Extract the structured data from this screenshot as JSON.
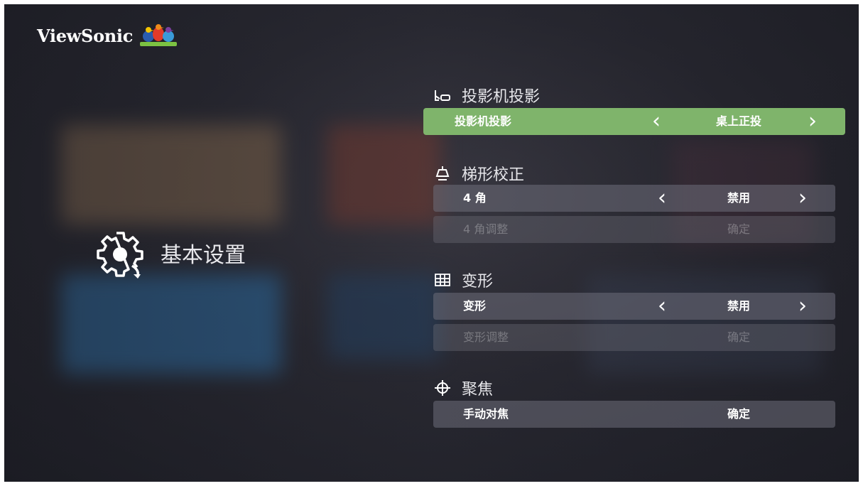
{
  "brand": {
    "name": "ViewSonic",
    "logo_icon": "viewsonic-birds-logo"
  },
  "left_menu": {
    "icon": "gear-icon",
    "title": "基本设置"
  },
  "sections": [
    {
      "title": "投影机投影",
      "icon": "projector-icon",
      "rows": [
        {
          "label": "投影机投影",
          "value": "桌上正投",
          "arrows": true,
          "selected": true,
          "enabled": true
        }
      ]
    },
    {
      "title": "梯形校正",
      "icon": "keystone-icon",
      "rows": [
        {
          "label": "4 角",
          "value": "禁用",
          "arrows": true,
          "selected": false,
          "enabled": true
        },
        {
          "label": "4 角调整",
          "value": "确定",
          "arrows": false,
          "selected": false,
          "enabled": false
        }
      ]
    },
    {
      "title": "变形",
      "icon": "warp-grid-icon",
      "rows": [
        {
          "label": "变形",
          "value": "禁用",
          "arrows": true,
          "selected": false,
          "enabled": true
        },
        {
          "label": "变形调整",
          "value": "确定",
          "arrows": false,
          "selected": false,
          "enabled": false
        }
      ]
    },
    {
      "title": "聚焦",
      "icon": "focus-crosshair-icon",
      "rows": [
        {
          "label": "手动对焦",
          "value": "确定",
          "arrows": false,
          "selected": false,
          "enabled": true
        }
      ]
    }
  ],
  "arrows": {
    "left": "‹",
    "right": "›"
  },
  "colors": {
    "selected_row": "#7fb46b",
    "row_bg": "#6e6e7a",
    "text": "#ffffff"
  }
}
